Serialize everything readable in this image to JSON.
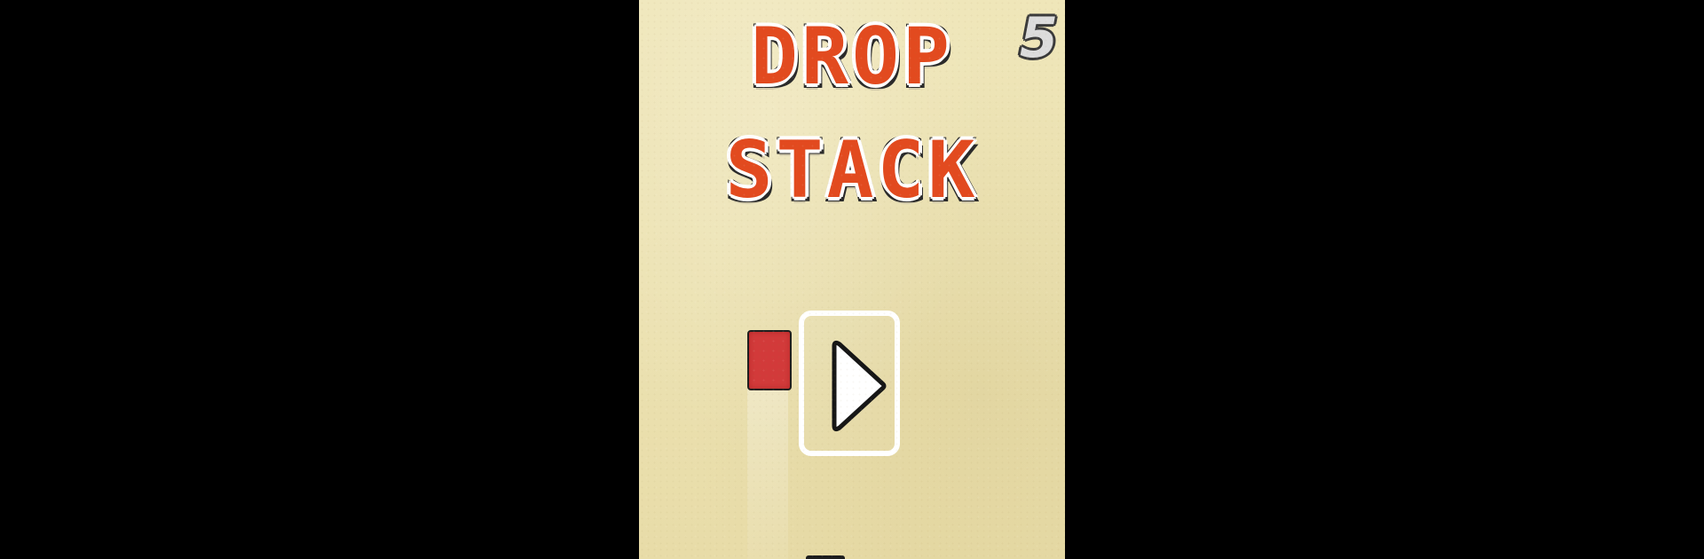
{
  "game": {
    "title_line1": "DROP",
    "title_line2": "STACK",
    "score": "5"
  },
  "colors": {
    "title": "#e24a1f",
    "block": "#d23a3a",
    "background": "#ece2b2",
    "outside": "#000000"
  },
  "icons": {
    "play": "play-triangle-icon"
  }
}
